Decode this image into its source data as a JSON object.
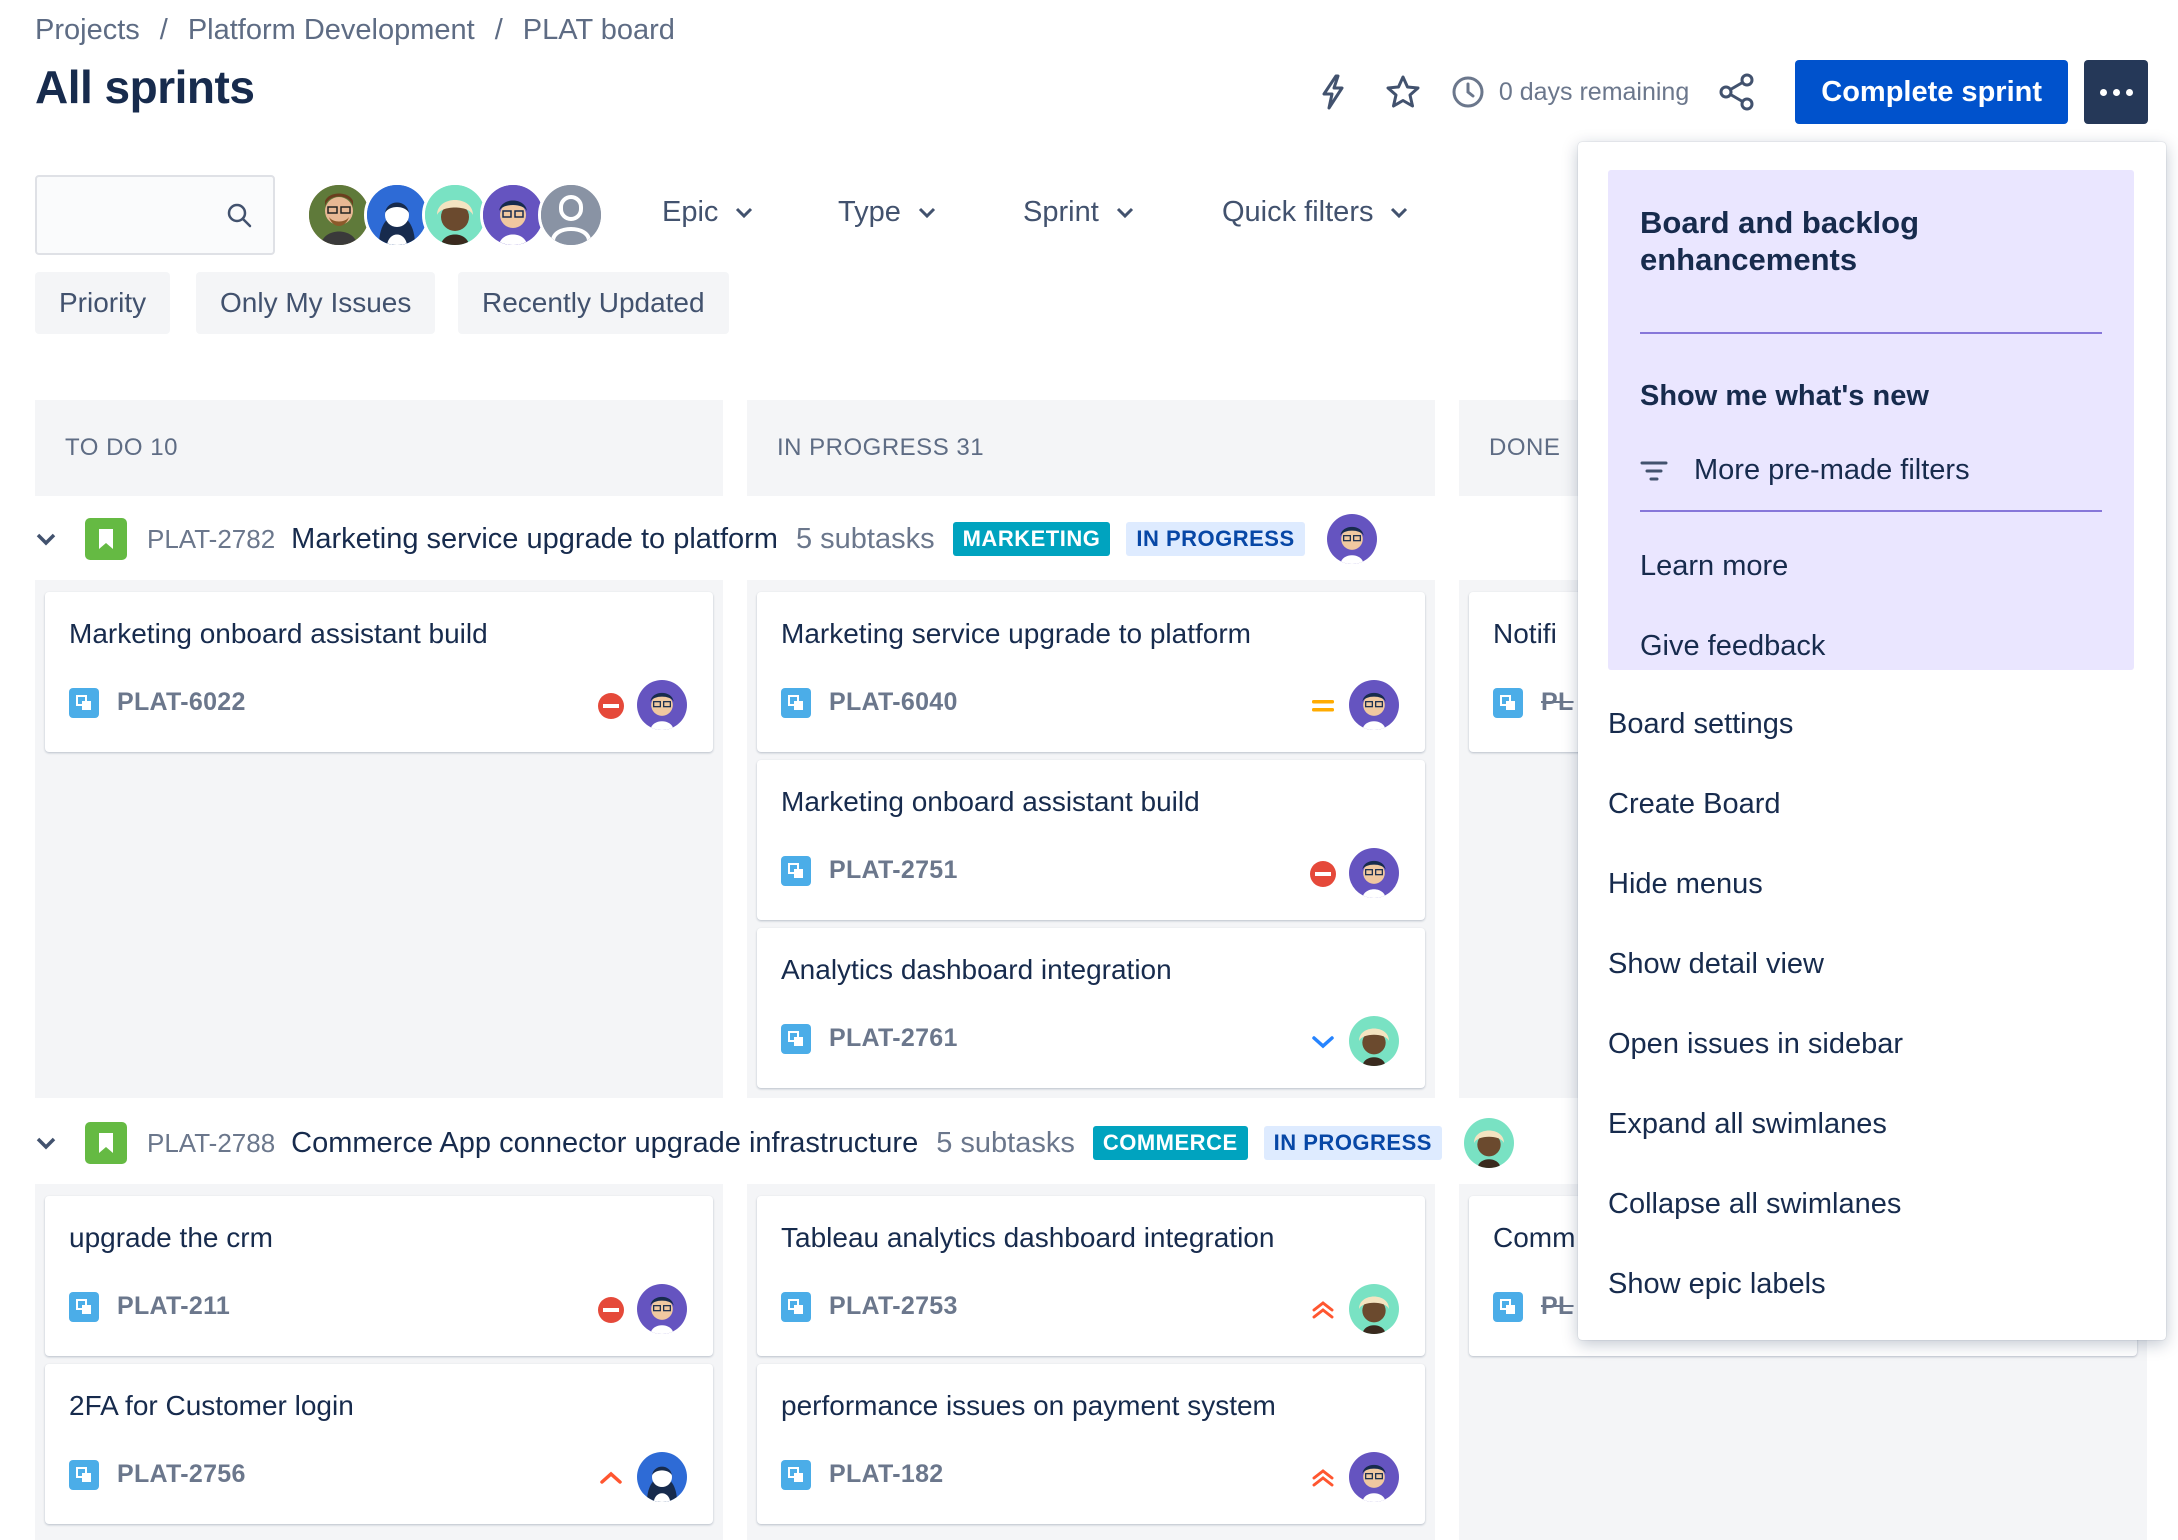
{
  "breadcrumb": [
    "Projects",
    "Platform Development",
    "PLAT board"
  ],
  "page_title": "All sprints",
  "header": {
    "days_remaining": "0 days remaining",
    "complete_sprint": "Complete sprint"
  },
  "filters": {
    "search_placeholder": "",
    "dropdowns": [
      "Epic",
      "Type",
      "Sprint",
      "Quick filters"
    ],
    "quick": [
      "Priority",
      "Only My Issues",
      "Recently Updated"
    ]
  },
  "columns": [
    {
      "label": "TO DO 10"
    },
    {
      "label": "IN PROGRESS 31"
    },
    {
      "label": "DONE"
    }
  ],
  "swimlanes": [
    {
      "key": "PLAT-2782",
      "summary": "Marketing service upgrade to platform",
      "subtasks": "5 subtasks",
      "epic_label": "MARKETING",
      "status": "IN PROGRESS",
      "todo": [
        {
          "title": "Marketing onboard assistant build",
          "key": "PLAT-6022",
          "priority": "blocker"
        }
      ],
      "inprogress": [
        {
          "title": "Marketing service upgrade to platform",
          "key": "PLAT-6040",
          "priority": "medium"
        },
        {
          "title": "Marketing onboard assistant build",
          "key": "PLAT-2751",
          "priority": "blocker"
        },
        {
          "title": "Analytics dashboard integration",
          "key": "PLAT-2761",
          "priority": "low"
        }
      ],
      "done": [
        {
          "title": "Notifi",
          "key": "PL"
        }
      ]
    },
    {
      "key": "PLAT-2788",
      "summary": "Commerce App connector upgrade infrastructure",
      "subtasks": "5 subtasks",
      "epic_label": "COMMERCE",
      "status": "IN PROGRESS",
      "todo": [
        {
          "title": "upgrade the crm",
          "key": "PLAT-211",
          "priority": "blocker"
        },
        {
          "title": "2FA for Customer login",
          "key": "PLAT-2756",
          "priority": "high"
        }
      ],
      "inprogress": [
        {
          "title": "Tableau analytics dashboard integration",
          "key": "PLAT-2753",
          "priority": "highest"
        },
        {
          "title": "performance issues on payment system",
          "key": "PLAT-182",
          "priority": "highest"
        }
      ],
      "done": [
        {
          "title": "Comm",
          "key": "PL"
        }
      ]
    }
  ],
  "menu": {
    "promo_title": "Board and backlog enhancements",
    "show_new": "Show me what's new",
    "more_filters": "More pre-made filters",
    "learn_more": "Learn more",
    "give_feedback": "Give feedback",
    "items": [
      "Board settings",
      "Create Board",
      "Hide menus",
      "Show detail view",
      "Open issues in sidebar",
      "Expand all swimlanes",
      "Collapse all swimlanes",
      "Show epic labels"
    ]
  },
  "colors": {
    "primary": "#0052cc",
    "epic_green": "#65ba43",
    "teal_lozenge": "#00a3bf",
    "promo_bg": "#eae6ff",
    "blocker": "#e5493a",
    "medium": "#ffab00",
    "low": "#2684ff"
  }
}
